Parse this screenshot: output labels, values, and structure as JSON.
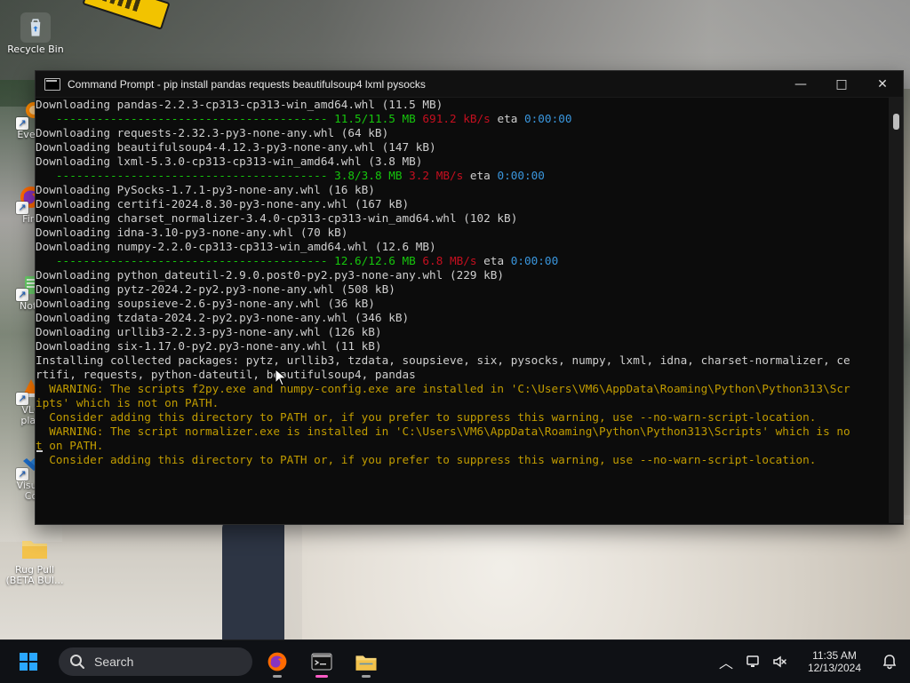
{
  "desktop": {
    "icons": [
      {
        "label": "Recycle Bin"
      },
      {
        "label": "Every"
      },
      {
        "label": "Fire"
      },
      {
        "label": "Note"
      },
      {
        "label": "VLC\nplay"
      },
      {
        "label": "Visual\nCo"
      },
      {
        "label": "Rug Pull\n(BETA BUI..."
      }
    ]
  },
  "window": {
    "title": "Command Prompt - pip  install pandas requests beautifulsoup4 lxml pysocks",
    "controls": {
      "minimize": "—",
      "maximize": "□",
      "close": "✕"
    }
  },
  "console_lines": [
    {
      "text": "Downloading pandas-2.2.3-cp313-cp313-win_amd64.whl (11.5 MB)"
    },
    {
      "segments": [
        {
          "text": "   ---------------------------------------- ",
          "color": "green"
        },
        {
          "text": "11.5/11.5 MB",
          "color": "green"
        },
        {
          "text": " ",
          "color": "dim"
        },
        {
          "text": "691.2 kB/s",
          "color": "red"
        },
        {
          "text": " eta ",
          "color": "dim"
        },
        {
          "text": "0:00:00",
          "color": "cyan"
        }
      ]
    },
    {
      "text": "Downloading requests-2.32.3-py3-none-any.whl (64 kB)"
    },
    {
      "text": "Downloading beautifulsoup4-4.12.3-py3-none-any.whl (147 kB)"
    },
    {
      "text": "Downloading lxml-5.3.0-cp313-cp313-win_amd64.whl (3.8 MB)"
    },
    {
      "segments": [
        {
          "text": "   ---------------------------------------- ",
          "color": "green"
        },
        {
          "text": "3.8/3.8 MB",
          "color": "green"
        },
        {
          "text": " ",
          "color": "dim"
        },
        {
          "text": "3.2 MB/s",
          "color": "red"
        },
        {
          "text": " eta ",
          "color": "dim"
        },
        {
          "text": "0:00:00",
          "color": "cyan"
        }
      ]
    },
    {
      "text": "Downloading PySocks-1.7.1-py3-none-any.whl (16 kB)"
    },
    {
      "text": "Downloading certifi-2024.8.30-py3-none-any.whl (167 kB)"
    },
    {
      "text": "Downloading charset_normalizer-3.4.0-cp313-cp313-win_amd64.whl (102 kB)"
    },
    {
      "text": "Downloading idna-3.10-py3-none-any.whl (70 kB)"
    },
    {
      "text": "Downloading numpy-2.2.0-cp313-cp313-win_amd64.whl (12.6 MB)"
    },
    {
      "segments": [
        {
          "text": "   ---------------------------------------- ",
          "color": "green"
        },
        {
          "text": "12.6/12.6 MB",
          "color": "green"
        },
        {
          "text": " ",
          "color": "dim"
        },
        {
          "text": "6.8 MB/s",
          "color": "red"
        },
        {
          "text": " eta ",
          "color": "dim"
        },
        {
          "text": "0:00:00",
          "color": "cyan"
        }
      ]
    },
    {
      "text": "Downloading python_dateutil-2.9.0.post0-py2.py3-none-any.whl (229 kB)"
    },
    {
      "text": "Downloading pytz-2024.2-py2.py3-none-any.whl (508 kB)"
    },
    {
      "text": "Downloading soupsieve-2.6-py3-none-any.whl (36 kB)"
    },
    {
      "text": "Downloading tzdata-2024.2-py2.py3-none-any.whl (346 kB)"
    },
    {
      "text": "Downloading urllib3-2.2.3-py3-none-any.whl (126 kB)"
    },
    {
      "text": "Downloading six-1.17.0-py2.py3-none-any.whl (11 kB)"
    },
    {
      "text": "Installing collected packages: pytz, urllib3, tzdata, soupsieve, six, pysocks, numpy, lxml, idna, charset-normalizer, ce"
    },
    {
      "text": "rtifi, requests, python-dateutil, beautifulsoup4, pandas"
    },
    {
      "text": "  WARNING: The scripts f2py.exe and numpy-config.exe are installed in 'C:\\Users\\VM6\\AppData\\Roaming\\Python\\Python313\\Scr",
      "color": "yellow"
    },
    {
      "text": "ipts' which is not on PATH.",
      "color": "yellow"
    },
    {
      "text": "  Consider adding this directory to PATH or, if you prefer to suppress this warning, use --no-warn-script-location.",
      "color": "yellow"
    },
    {
      "text": "  WARNING: The script normalizer.exe is installed in 'C:\\Users\\VM6\\AppData\\Roaming\\Python\\Python313\\Scripts' which is no",
      "color": "yellow"
    },
    {
      "text": "t on PATH.",
      "color": "yellow"
    },
    {
      "text": "  Consider adding this directory to PATH or, if you prefer to suppress this warning, use --no-warn-script-location.",
      "color": "yellow"
    }
  ],
  "taskbar": {
    "search_placeholder": "Search",
    "clock_time": "11:35 AM",
    "clock_date": "12/13/2024"
  },
  "colors": {
    "green": "#16c60c",
    "red": "#c50f1f",
    "cyan": "#3a96dd",
    "yellow": "#c19c00",
    "dim": "#cfcfcf"
  }
}
